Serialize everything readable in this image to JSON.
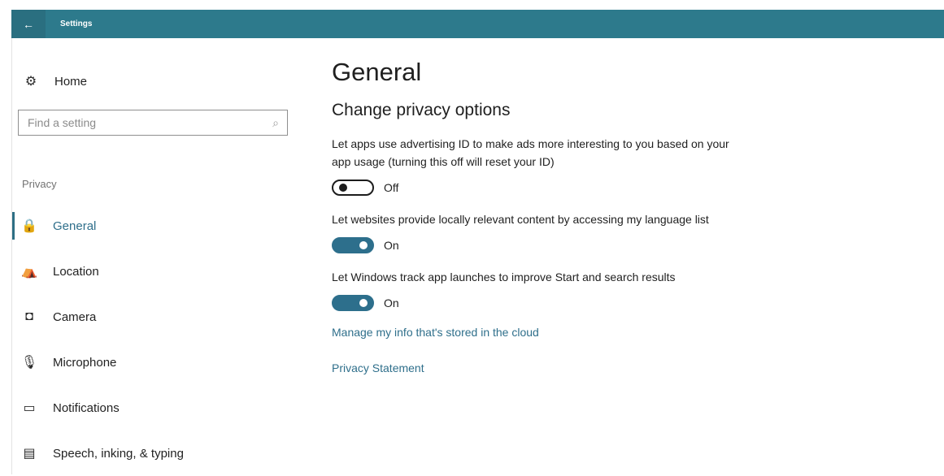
{
  "window": {
    "title": "Settings",
    "back_icon": "back-arrow-icon"
  },
  "sidebar": {
    "home": {
      "label": "Home",
      "icon": "gear-icon"
    },
    "search": {
      "placeholder": "Find a setting",
      "icon": "search-icon"
    },
    "section_label": "Privacy",
    "items": [
      {
        "label": "General",
        "icon": "lock-icon",
        "active": true
      },
      {
        "label": "Location",
        "icon": "location-icon"
      },
      {
        "label": "Camera",
        "icon": "camera-icon"
      },
      {
        "label": "Microphone",
        "icon": "microphone-icon"
      },
      {
        "label": "Notifications",
        "icon": "notification-icon"
      },
      {
        "label": "Speech, inking, & typing",
        "icon": "clipboard-icon"
      }
    ]
  },
  "main": {
    "title": "General",
    "subtitle": "Change privacy options",
    "settings": [
      {
        "description": "Let apps use advertising ID to make ads more interesting to you based on your app usage (turning this off will reset your ID)",
        "state": "Off"
      },
      {
        "description": "Let websites provide locally relevant content by accessing my language list",
        "state": "On"
      },
      {
        "description": "Let Windows track app launches to improve Start and search results",
        "state": "On"
      }
    ],
    "links": [
      "Manage my info that's stored in the cloud",
      "Privacy Statement"
    ]
  },
  "colors": {
    "accent": "#2d6f8c",
    "titlebar": "#2d7a8c"
  }
}
